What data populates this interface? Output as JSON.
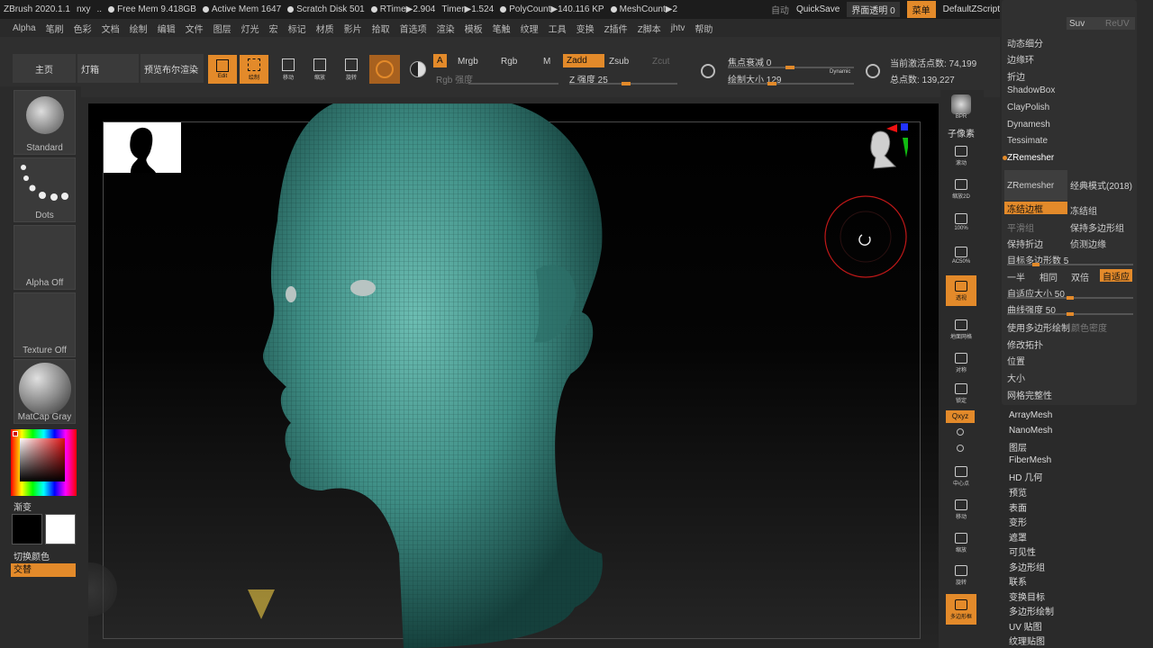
{
  "titlebar": {
    "app": "ZBrush 2020.1.1",
    "user": "nxy",
    "dots": "..",
    "free_mem": "Free Mem 9.418GB",
    "active_mem": "Active Mem 1647",
    "scratch": "Scratch Disk 501",
    "rtime": "RTime▶2.904",
    "timer": "Timer▶1.524",
    "polycount": "PolyCount▶140.116 KP",
    "meshcount": "MeshCount▶2",
    "auto_save": "自动",
    "quicksave": "QuickSave",
    "transparency": "界面透明 0",
    "menu": "菜单",
    "script": "DefaultZScript"
  },
  "menu": [
    "Alpha",
    "笔刷",
    "色彩",
    "文档",
    "绘制",
    "编辑",
    "文件",
    "图层",
    "灯光",
    "宏",
    "标记",
    "材质",
    "影片",
    "拾取",
    "首选项",
    "渲染",
    "模板",
    "笔触",
    "纹理",
    "工具",
    "变换",
    "Z插件",
    "Z脚本",
    "jhtv",
    "帮助"
  ],
  "toolbar": {
    "home": "主页",
    "lightbox": "灯箱",
    "bpr": "预览布尔渲染",
    "edit": "Edit",
    "draw": "绘制",
    "move": "移动",
    "scale": "缩放",
    "rotate": "旋转",
    "a": "A",
    "mrgb": "Mrgb",
    "rgb": "Rgb",
    "m": "M",
    "zadd": "Zadd",
    "zsub": "Zsub",
    "zcut": "Zcut",
    "rgb_intensity": "Rgb 强度",
    "z_intensity": "Z 强度 25",
    "z_intensity_value": 25,
    "focal_shift": "焦点衰减 0",
    "draw_size": "绘制大小 129",
    "draw_size_value": 129,
    "dynamic": "Dynamic",
    "active_points": "当前激活点数: 74,199",
    "total_points": "总点数: 139,227"
  },
  "left": {
    "brush": "Standard",
    "stroke": "Dots",
    "alpha": "Alpha Off",
    "texture": "Texture Off",
    "material": "MatCap Gray",
    "gradient": "渐变",
    "switch_color": "切换颜色",
    "alternate": "交替"
  },
  "rightshelf": [
    "BPR",
    "子像素",
    "滚动",
    "缩放2D",
    "100%",
    "AC50%",
    "透视",
    "地面网格",
    "对称",
    "锁定",
    "Qxyz",
    "中心点",
    "移动",
    "缩放",
    "旋转",
    "多边形框"
  ],
  "rpanel": {
    "top_a": "Suv",
    "top_b": "ReUV",
    "items": [
      "动态细分",
      "边缘环",
      "折边",
      "ShadowBox",
      "ClayPolish",
      "Dynamesh",
      "Tessimate"
    ],
    "zremesher_header": "ZRemesher",
    "zremesher_btn": "ZRemesher",
    "legacy": "经典模式(2018)",
    "freeze_border": "冻结边框",
    "freeze_groups": "冻结组",
    "smooth_groups": "平滑组",
    "keep_groups": "保持多边形组",
    "keep_creases": "保持折边",
    "detect_edges": "侦测边缘",
    "target_poly": "目标多边形数 5",
    "target_poly_value": 5,
    "half": "一半",
    "same": "相同",
    "double": "双倍",
    "adaptive": "自适应",
    "adaptive_size": "自适应大小 50",
    "adaptive_size_value": 50,
    "curve_strength": "曲线强度 50",
    "curve_strength_value": 50,
    "use_polypaint": "使用多边形绘制",
    "color_density": "颜色密度",
    "modify_topology": "修改拓扑",
    "position": "位置",
    "size": "大小",
    "mesh_integrity": "网格完整性",
    "subpalettes": [
      "ArrayMesh",
      "NanoMesh",
      "图层",
      "FiberMesh",
      "HD 几何",
      "预览",
      "表面",
      "变形",
      "遮罩",
      "可见性",
      "多边形组",
      "联系",
      "变换目标",
      "多边形绘制",
      "UV 贴图",
      "纹理贴图"
    ]
  },
  "colors": {
    "accent": "#e38a2a",
    "mesh": "#3f8f86",
    "background": "#2b2b2b"
  }
}
